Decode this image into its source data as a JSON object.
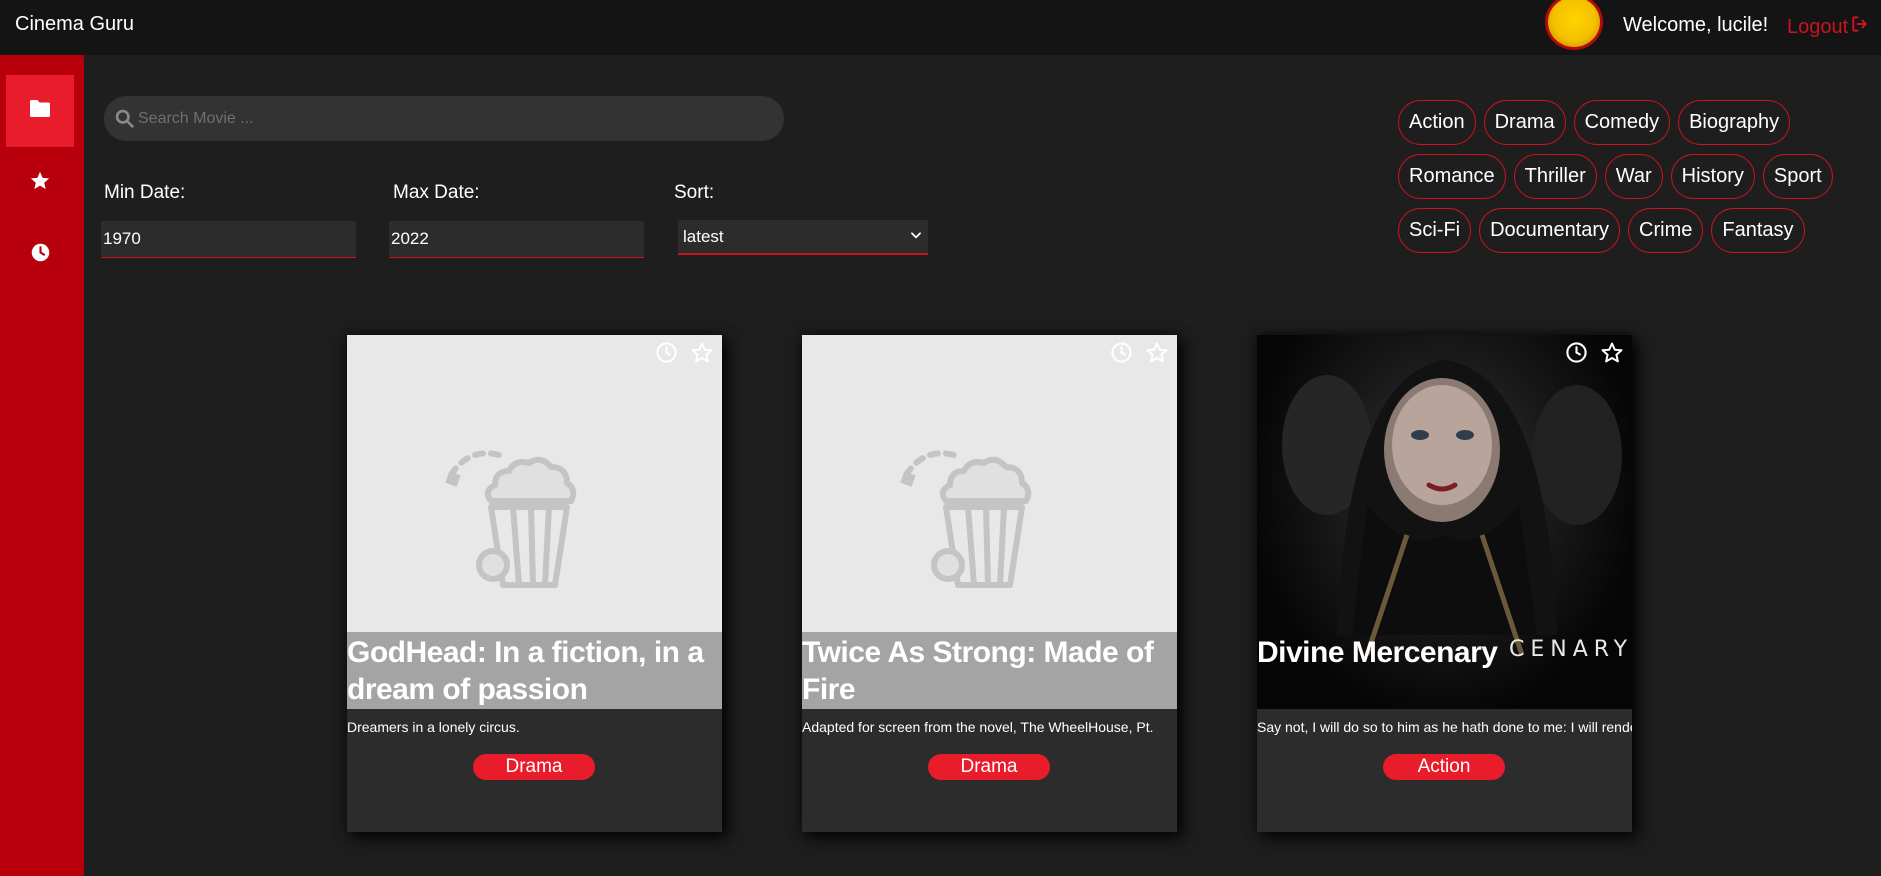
{
  "header": {
    "app_title": "Cinema Guru",
    "welcome": "Welcome, lucile!",
    "logout_label": "Logout"
  },
  "sidebar": {
    "items": [
      {
        "icon": "folder-icon",
        "active": true
      },
      {
        "icon": "star-icon",
        "active": false
      },
      {
        "icon": "clock-icon",
        "active": false
      }
    ]
  },
  "filters": {
    "search_placeholder": "Search Movie ...",
    "min_date_label": "Min Date:",
    "min_date_value": "1970",
    "max_date_label": "Max Date:",
    "max_date_value": "2022",
    "sort_label": "Sort:",
    "sort_value": "latest"
  },
  "genres": [
    [
      "Action",
      "Drama",
      "Comedy",
      "Biography"
    ],
    [
      "Romance",
      "Thriller",
      "War",
      "History",
      "Sport"
    ],
    [
      "Sci-Fi",
      "Documentary",
      "Crime",
      "Fantasy"
    ]
  ],
  "movies": [
    {
      "title": "GodHead: In a fiction, in a dream of passion",
      "description": "Dreamers in a lonely circus.",
      "genre": "Drama",
      "poster": "placeholder"
    },
    {
      "title": "Twice As Strong: Made of Fire",
      "description": "Adapted for screen from the novel, The WheelHouse, Pt.",
      "genre": "Drama",
      "poster": "placeholder"
    },
    {
      "title": "Divine Mercenary",
      "description": "Say not, I will do so to him as he hath done to me: I will render to the man",
      "genre": "Action",
      "poster": "image",
      "poster_text": "CENARY"
    }
  ],
  "colors": {
    "accent": "#c8141f",
    "sidebar": "#b8000c",
    "header": "#141414",
    "background": "#1e1e1e"
  }
}
